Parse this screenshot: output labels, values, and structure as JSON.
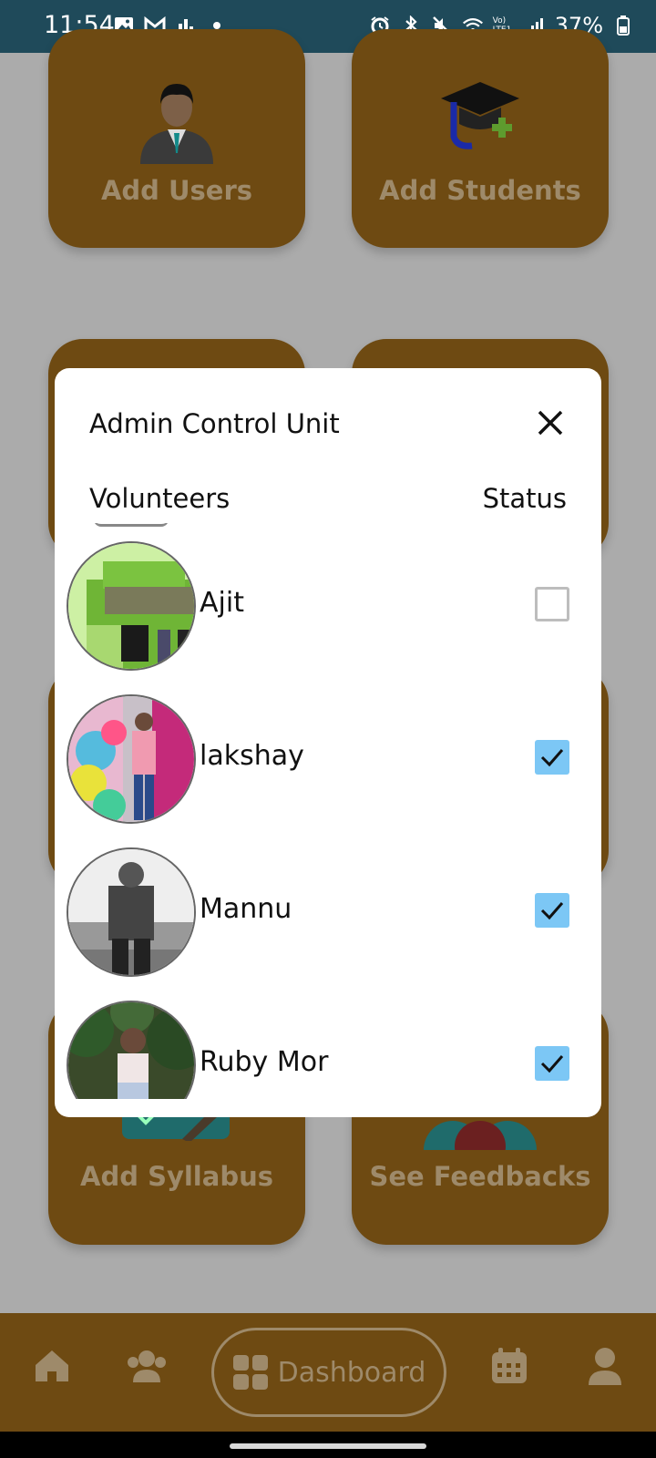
{
  "status_bar": {
    "time": "11:54",
    "battery": "37%",
    "left_icons": [
      "gallery-icon",
      "gmail-icon",
      "bars-icon"
    ],
    "right_icons": [
      "alarm-icon",
      "bluetooth-icon",
      "mute-icon",
      "wifi-icon",
      "volte-icon",
      "signal-icon",
      "battery-icon"
    ],
    "volte_label": "Vo) LTE1"
  },
  "dashboard": {
    "cards": [
      {
        "label": "Add Users",
        "icon": "user-icon"
      },
      {
        "label": "Add Students",
        "icon": "graduation-cap-icon"
      },
      {
        "label": "Add Syllabus",
        "icon": "syllabus-icon"
      },
      {
        "label": "See Feedbacks",
        "icon": "feedback-icon"
      }
    ]
  },
  "bottom_nav": {
    "items": [
      "home-icon",
      "people-icon",
      "calendar-icon",
      "profile-icon"
    ],
    "active_label": "Dashboard",
    "active_icon": "grid-icon"
  },
  "modal": {
    "title": "Admin Control Unit",
    "close_icon": "close-icon",
    "col_volunteers": "Volunteers",
    "col_status": "Status",
    "volunteers": [
      {
        "name": "Ajit",
        "checked": false
      },
      {
        "name": "lakshay",
        "checked": true
      },
      {
        "name": "Mannu",
        "checked": true
      },
      {
        "name": "Ruby Mor",
        "checked": true
      }
    ]
  },
  "colors": {
    "card": "#6e4a12",
    "overlay_bg": "#ababab",
    "checkbox_on": "#7cc7f5",
    "statusbar": "#1f4a5a"
  }
}
